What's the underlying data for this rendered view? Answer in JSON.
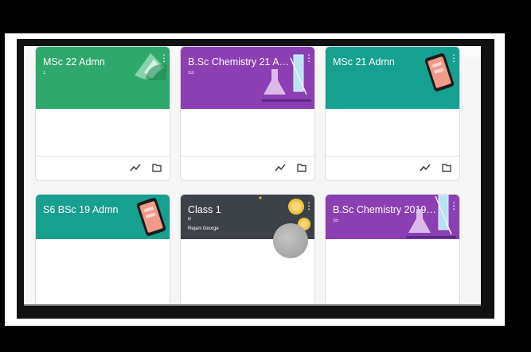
{
  "classes": [
    {
      "name": "MSc 22 Admn",
      "section": "1",
      "teacher": "",
      "color": "#2ea86b",
      "art": "teal-diamond"
    },
    {
      "name": "B.Sc Chemistry 21 Ad...",
      "section": "S3",
      "teacher": "",
      "color": "#8c3fb3",
      "art": "flask"
    },
    {
      "name": "MSc 21 Admn",
      "section": "",
      "teacher": "",
      "color": "#16a08f",
      "art": "phone"
    },
    {
      "name": "S6 BSc 19 Admn",
      "section": "",
      "teacher": "",
      "color": "#16a08f",
      "art": "phone"
    },
    {
      "name": "Class 1",
      "section": "B",
      "teacher": "Rejani George",
      "color": "#3d4248",
      "art": "lightbulb"
    },
    {
      "name": "B.Sc Chemistry 2019 ...",
      "section": "S5",
      "teacher": "",
      "color": "#8c3fb3",
      "art": "flask"
    }
  ],
  "icons": {
    "trend": "trending-up-icon",
    "folder": "folder-icon",
    "more": "more-vert-icon"
  }
}
